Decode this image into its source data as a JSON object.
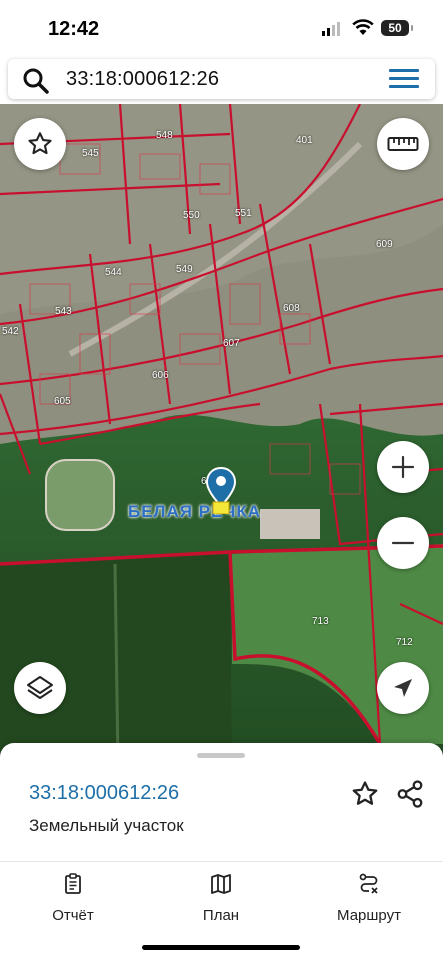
{
  "status": {
    "time": "12:42",
    "battery": "50"
  },
  "search": {
    "query": "33:18:000612:26"
  },
  "map": {
    "parcel_labels": [
      "548",
      "545",
      "401",
      "550",
      "551",
      "609",
      "544",
      "549",
      "543",
      "542",
      "608",
      "607",
      "606",
      "605",
      "713",
      "712",
      "6"
    ],
    "place_name": "БЕЛАЯ РЕЧКА"
  },
  "sheet": {
    "parcel_id": "33:18:000612:26",
    "parcel_type": "Земельный участок"
  },
  "tabs": [
    {
      "label": "Отчёт",
      "icon": "report-icon"
    },
    {
      "label": "План",
      "icon": "map-plan-icon"
    },
    {
      "label": "Маршрут",
      "icon": "route-icon"
    }
  ],
  "colors": {
    "accent": "#1e6fa8",
    "boundary": "#c8102e",
    "pin": "#1e6fa8"
  }
}
